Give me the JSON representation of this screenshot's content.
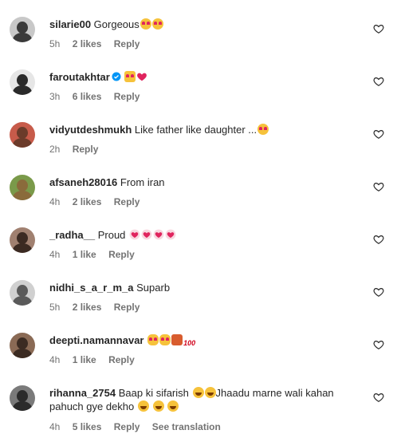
{
  "comments": [
    {
      "username": "silarie00",
      "text": "Gorgeous",
      "emojis": [
        "heart-eyes-face",
        "heart-eyes-face"
      ],
      "time": "5h",
      "likes": "2 likes",
      "reply": "Reply",
      "avatar_colors": [
        "#3a3a3a",
        "#bfbfbf"
      ]
    },
    {
      "username": "faroutakhtar",
      "verified": true,
      "text": "",
      "emojis": [
        "raising-hands",
        "red-heart"
      ],
      "time": "3h",
      "likes": "6 likes",
      "reply": "Reply",
      "avatar_colors": [
        "#2a2a2a",
        "#e6e6e6"
      ]
    },
    {
      "username": "vidyutdeshmukh",
      "text": "Like father like daughter ...",
      "emojis": [
        "heart-eyes-face"
      ],
      "time": "2h",
      "likes": "",
      "reply": "Reply",
      "avatar_colors": [
        "#6b3b2a",
        "#c75b4a"
      ]
    },
    {
      "username": "afsaneh28016",
      "text": "From iran",
      "emojis": [],
      "time": "4h",
      "likes": "2 likes",
      "reply": "Reply",
      "avatar_colors": [
        "#8a6b3b",
        "#7a9a4a"
      ]
    },
    {
      "username": "_radha__",
      "text": "Proud",
      "emojis": [
        "red-heart",
        "red-heart",
        "red-heart",
        "red-heart"
      ],
      "time": "4h",
      "likes": "1 like",
      "reply": "Reply",
      "avatar_colors": [
        "#3b2a22",
        "#a08070"
      ]
    },
    {
      "username": "nidhi_s_a_r_m_a",
      "text": "Suparb",
      "emojis": [],
      "time": "5h",
      "likes": "2 likes",
      "reply": "Reply",
      "avatar_colors": [
        "#5a5a5a",
        "#d0d0d0"
      ]
    },
    {
      "username": "deepti.namannavar",
      "text": "",
      "emojis": [
        "ok-hand",
        "ok-hand",
        "dancer",
        "hundred-points"
      ],
      "time": "4h",
      "likes": "1 like",
      "reply": "Reply",
      "avatar_colors": [
        "#3b2b22",
        "#8a6a55"
      ]
    },
    {
      "username": "rihanna_2754",
      "text": "Baap ki sifarish",
      "text2": "Jhaadu marne wali kahan",
      "text3": "pahuch gye dekho",
      "emojis": [
        "rofl-face",
        "rofl-face"
      ],
      "emojis2": [
        "laughing-face",
        "laughing-face",
        "laughing-face"
      ],
      "time": "4h",
      "likes": "5 likes",
      "reply": "Reply",
      "see_translation": "See translation",
      "avatar_colors": [
        "#2b2b2b",
        "#7a7a7a"
      ]
    }
  ],
  "colors": {
    "text": "#262626",
    "meta": "#737373",
    "verified": "#0095f6",
    "heart_outline": "#262626"
  }
}
